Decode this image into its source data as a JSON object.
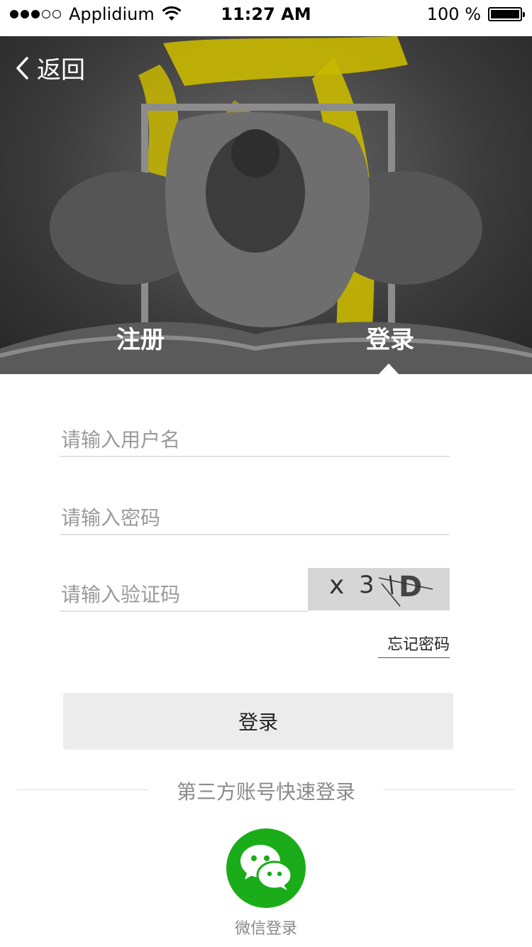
{
  "status_bar": {
    "carrier": "Applidium",
    "time": "11:27 AM",
    "battery": "100 %",
    "signal_bars_filled": 3,
    "signal_bars_total": 5
  },
  "header": {
    "back_label": "返回",
    "tabs": [
      {
        "label": "注册",
        "active": false
      },
      {
        "label": "登录",
        "active": true
      }
    ]
  },
  "form": {
    "username_placeholder": "请输入用户名",
    "password_placeholder": "请输入密码",
    "captcha_placeholder": "请输入验证码",
    "captcha_text": [
      "x",
      "3",
      "\\",
      "D"
    ],
    "forgot_label": "忘记密码",
    "submit_label": "登录"
  },
  "third_party": {
    "title": "第三方账号快速登录",
    "wechat_label": "微信登录",
    "wechat_icon": "wechat-icon"
  },
  "colors": {
    "wechat_green": "#1aad19",
    "accent_yellow": "#c9b800",
    "button_bg": "#ececec",
    "captcha_bg": "#d6d6d6"
  }
}
